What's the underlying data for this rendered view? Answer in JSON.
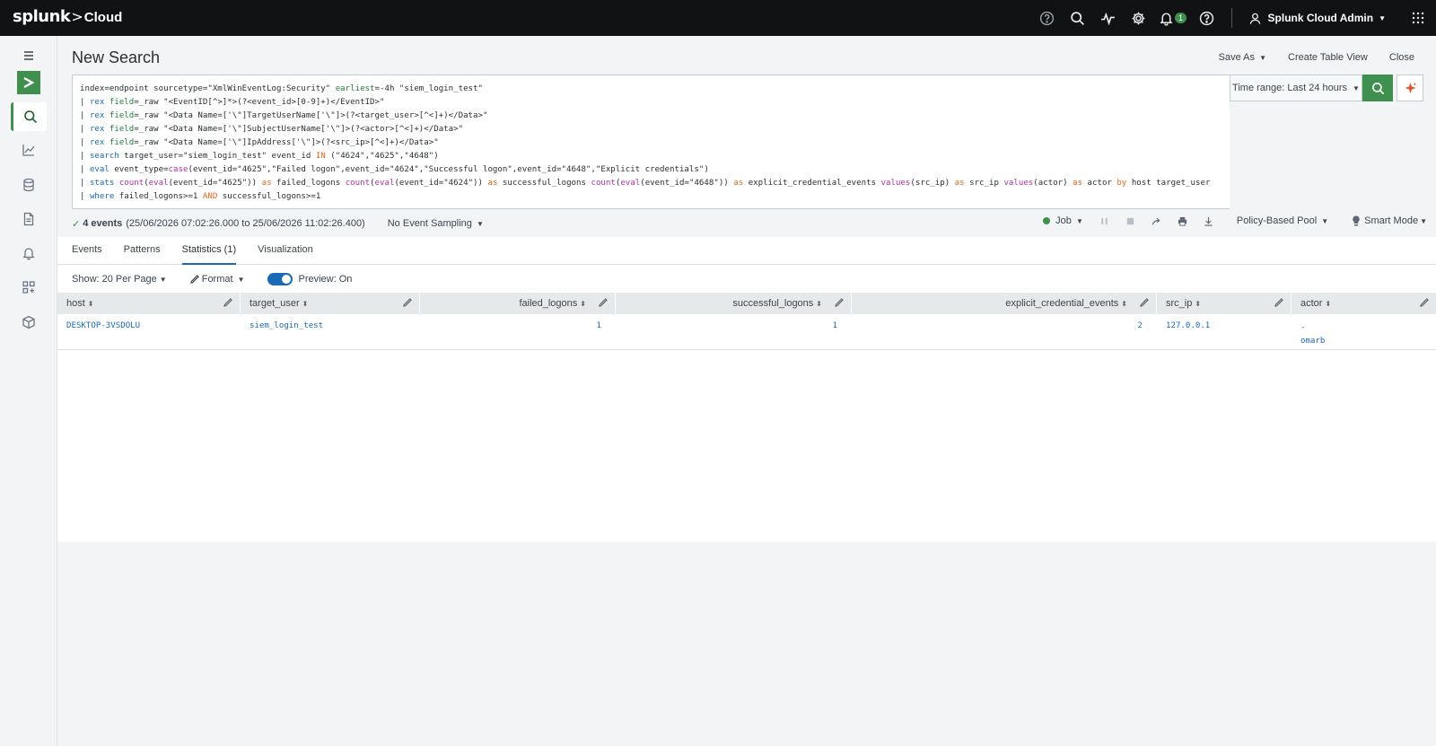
{
  "topbar": {
    "brand": "splunk",
    "chevron": ">",
    "product": "Cloud",
    "notification_count": "1",
    "user_label": "Splunk Cloud Admin"
  },
  "page": {
    "title": "New Search",
    "save_as": "Save As",
    "create_table_view": "Create Table View",
    "close": "Close"
  },
  "search": {
    "lines": [
      "index=endpoint sourcetype=\"XmlWinEventLog:Security\" earliest=-4h \"siem_login_test\"",
      "| rex field=_raw \"<EventID[^>]*>(?<event_id>[0-9]+)</EventID>\"",
      "| rex field=_raw \"<Data Name=['\\\"]TargetUserName['\\\"]>(?<target_user>[^<]+)</Data>\"",
      "| rex field=_raw \"<Data Name=['\\\"]SubjectUserName['\\\"]>(?<actor>[^<]+)</Data>\"",
      "| rex field=_raw \"<Data Name=['\\\"]IpAddress['\\\"]>(?<src_ip>[^<]+)</Data>\"",
      "| search target_user=\"siem_login_test\" event_id IN (\"4624\",\"4625\",\"4648\")",
      "| eval event_type=case(event_id=\"4625\",\"Failed logon\",event_id=\"4624\",\"Successful logon\",event_id=\"4648\",\"Explicit credentials\")",
      "| stats count(eval(event_id=\"4625\")) as failed_logons count(eval(event_id=\"4624\")) as successful_logons count(eval(event_id=\"4648\")) as explicit_credential_events values(src_ip) as src_ip values(actor) as actor by host target_user",
      "| where failed_logons>=1 AND successful_logons>=1"
    ],
    "time_range": "Time range: Last 24 hours"
  },
  "status": {
    "check": "✓",
    "events_count": "4 events",
    "range": "(25/06/2026 07:02:26.000 to 25/06/2026 11:02:26.400)",
    "sampling": "No Event Sampling",
    "job": "Job",
    "pool": "Policy-Based Pool",
    "mode": "Smart Mode"
  },
  "tabs": [
    {
      "label": "Events"
    },
    {
      "label": "Patterns"
    },
    {
      "label": "Statistics (1)"
    },
    {
      "label": "Visualization"
    }
  ],
  "results_toolbar": {
    "show": "Show: 20 Per Page",
    "format": "Format",
    "preview": "Preview: On"
  },
  "table": {
    "columns": [
      "host",
      "target_user",
      "failed_logons",
      "successful_logons",
      "explicit_credential_events",
      "src_ip",
      "actor"
    ],
    "rows": [
      {
        "host": "DESKTOP-3VSDOLU",
        "target_user": "siem_login_test",
        "failed_logons": "1",
        "successful_logons": "1",
        "explicit_credential_events": "2",
        "src_ip": "127.0.0.1",
        "actor": [
          "-",
          "omarb"
        ]
      }
    ]
  },
  "icons": {
    "topbar": [
      "help-circle-icon",
      "search-icon",
      "activity-icon",
      "gear-icon",
      "bell-icon",
      "help-icon",
      "user-icon",
      "apps-grid-icon"
    ],
    "rail": [
      "hamburger-icon",
      "app-logo-icon",
      "search-icon",
      "chart-icon",
      "database-icon",
      "report-icon",
      "alert-icon",
      "dashboard-icon",
      "datasets-icon"
    ]
  },
  "colors": {
    "accent_green": "#3f8f4e",
    "link_blue": "#1a6ab8",
    "topbar_bg": "#111214"
  }
}
